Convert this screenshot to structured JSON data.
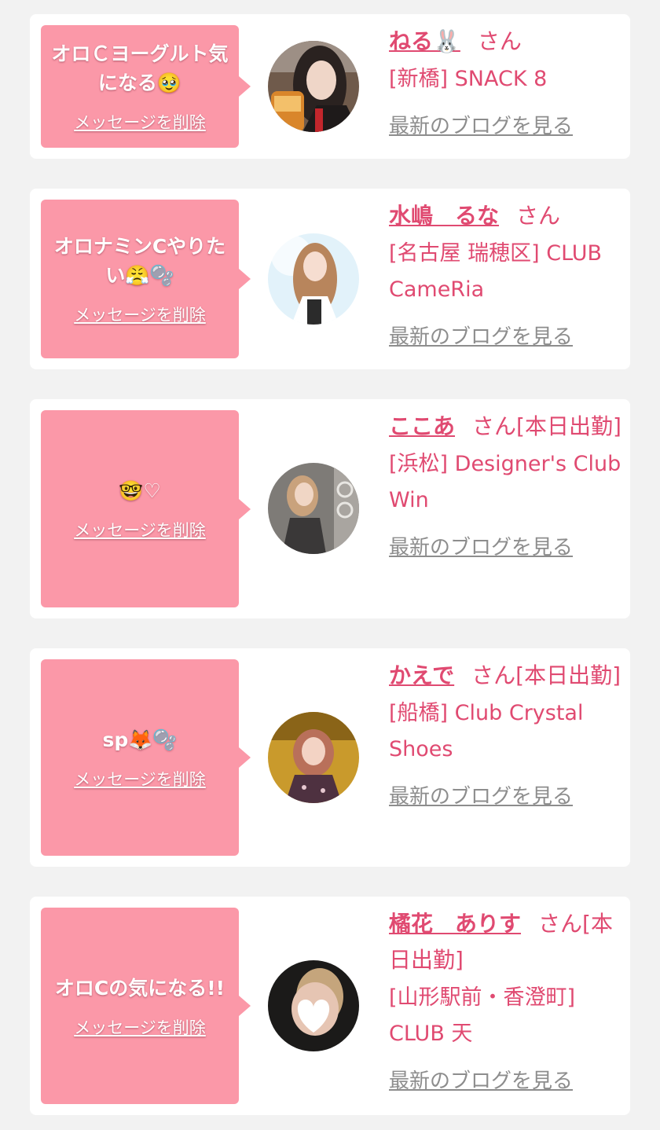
{
  "colors": {
    "page_background": "#f2f2f2",
    "card_background": "#ffffff",
    "bubble_background": "#fb98a8",
    "name_text": "#e04a71",
    "link_gray": "#8d8d8d"
  },
  "messages": [
    {
      "message": "オロＣヨーグルト気になる🥹",
      "delete_label": "メッセージを削除",
      "name": "ねる🐰",
      "honorific": "さん",
      "shop": "[新橋] SNACK 8",
      "blog_link": "最新のブログを見る",
      "avatar_icon": "profile-photo-woman-with-drink"
    },
    {
      "message": "オロナミンCやりたい😤🫧",
      "delete_label": "メッセージを削除",
      "name": "水嶋　るな",
      "honorific": "さん",
      "shop": "[名古屋 瑞穂区] CLUB CameRia",
      "blog_link": "最新のブログを見る",
      "avatar_icon": "profile-photo-long-hair-woman"
    },
    {
      "message": "🤓♡",
      "delete_label": "メッセージを削除",
      "name": "ここあ",
      "honorific": "さん[本日出勤]",
      "shop": "[浜松] Designer's Club Win",
      "blog_link": "最新のブログを見る",
      "avatar_icon": "profile-photo-woman-coco-sign"
    },
    {
      "message": "sp🦊🫧",
      "delete_label": "メッセージを削除",
      "name": "かえで",
      "honorific": "さん[本日出勤]",
      "shop": "[船橋] Club Crystal Shoes",
      "blog_link": "最新のブログを見る",
      "avatar_icon": "profile-photo-woman-gold-background"
    },
    {
      "message": "オロCの気になる!!",
      "delete_label": "メッセージを削除",
      "name": "橘花　ありす",
      "honorific": "さん[本日出勤]",
      "shop": "[山形駅前・香澄町] CLUB 天",
      "blog_link": "最新のブログを見る",
      "avatar_icon": "profile-photo-heart-sticker"
    }
  ]
}
